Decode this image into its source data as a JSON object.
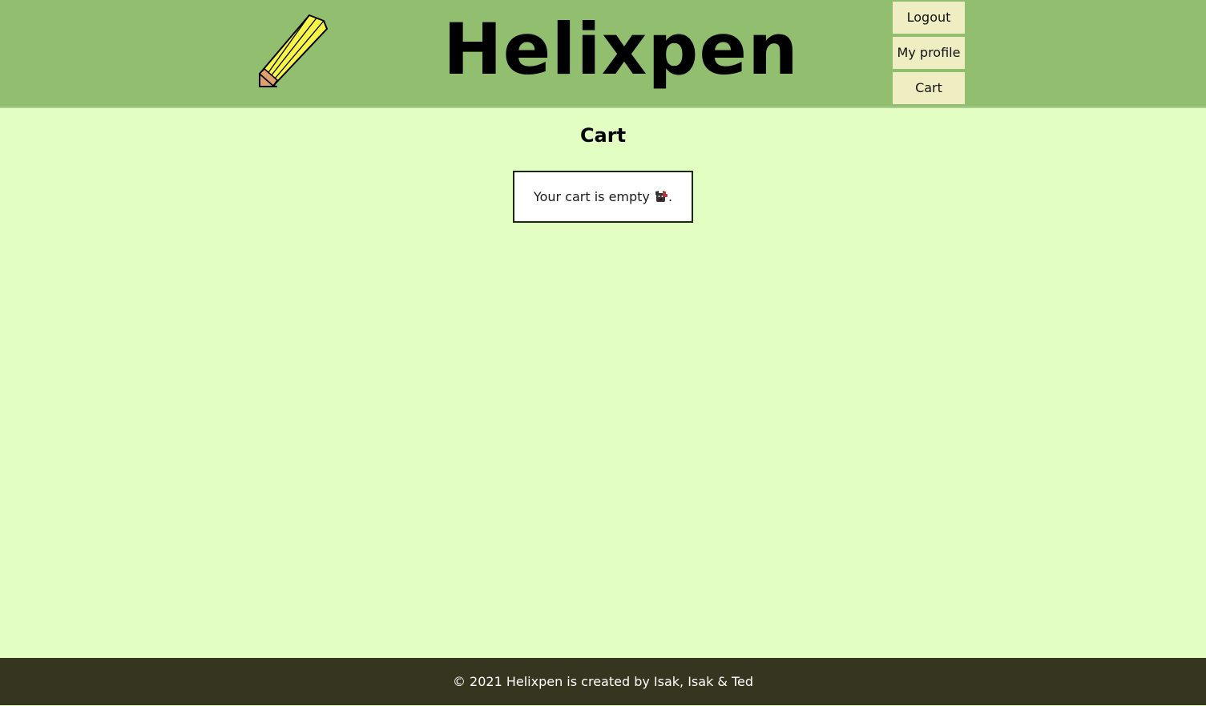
{
  "header": {
    "logo_icon": "pencil-icon",
    "title": "Helixpen",
    "nav": {
      "logout_label": "Logout",
      "profile_label": "My profile",
      "cart_label": "Cart"
    }
  },
  "main": {
    "heading": "Cart",
    "empty_message": "Your cart is empty",
    "empty_icon": "dog-face-icon",
    "empty_suffix": "."
  },
  "footer": {
    "text": "© 2021 Helixpen is created by Isak, Isak & Ted"
  },
  "colors": {
    "header_bg": "#92be6f",
    "page_bg": "#e3fec3",
    "nav_button_bg": "#eeeec2",
    "footer_bg": "#363520",
    "pencil_body": "#f7f54a",
    "pencil_tip": "#e0a070"
  }
}
